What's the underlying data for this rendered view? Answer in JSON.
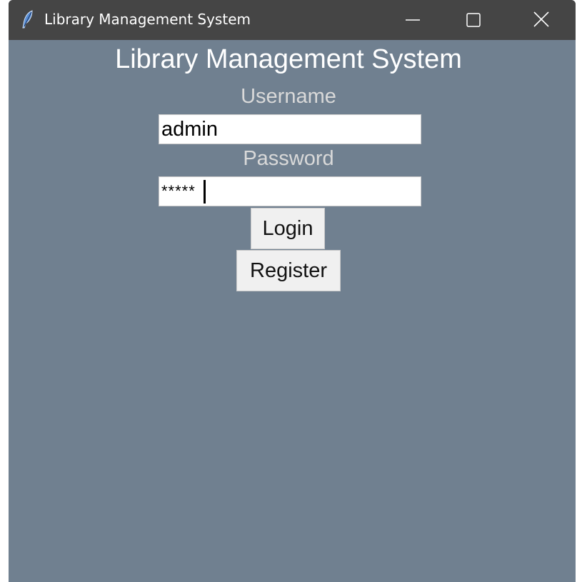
{
  "window": {
    "title": "Library Management System",
    "controls": {
      "minimize": "minimize-icon",
      "maximize": "maximize-icon",
      "close": "close-icon"
    },
    "app_icon": "feather-icon"
  },
  "form": {
    "heading": "Library Management System",
    "username_label": "Username",
    "username_value": "admin",
    "password_label": "Password",
    "password_value": "*****",
    "login_label": "Login",
    "register_label": "Register"
  },
  "colors": {
    "background": "#708090",
    "titlebar": "#454545",
    "button": "#f0f0f0"
  }
}
